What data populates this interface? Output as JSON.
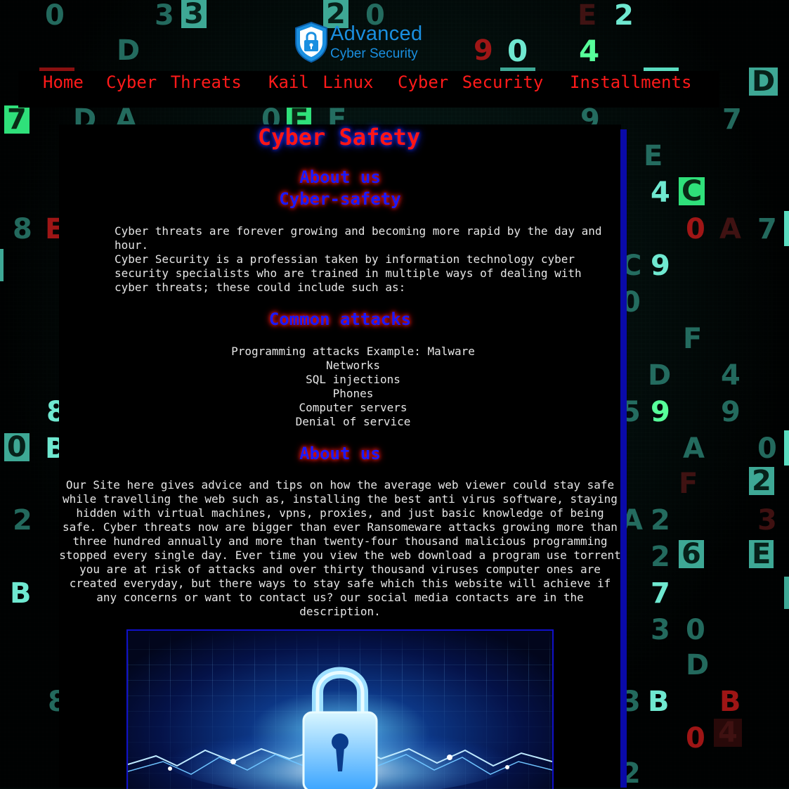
{
  "logo": {
    "line1": "Advanced",
    "line2": "Cyber Security",
    "icon": "lock-shield-icon",
    "color": "#1a8fe0"
  },
  "nav": {
    "items": [
      {
        "label": "Home"
      },
      {
        "label": "Cyber Threats"
      },
      {
        "label": "Kail Linux"
      },
      {
        "label": "Cyber Security"
      },
      {
        "label": "Installments"
      }
    ],
    "color": "#ff1a1a"
  },
  "main": {
    "title": "Cyber Safety",
    "about_heading": "About us",
    "cyber_safety_heading": "Cyber-safety",
    "intro_line1": "Cyber threats are forever growing and becoming more rapid by the day and hour.",
    "intro_line2": "Cyber Security is a professian taken by information technology cyber security specialists who are trained in multiple ways of dealing with cyber threats; these could include such as:",
    "attacks_heading": "Common attacks",
    "attacks": [
      "Programming attacks Example: Malware",
      "Networks",
      "SQL injections",
      "Phones",
      "Computer servers",
      "Denial of service"
    ],
    "about_heading_2": "About us",
    "about_text": "Our Site here gives advice and tips on how the average web viewer could stay safe while travelling the web such as, installing the best anti virus software, staying hidden with virtual machines, vpns, proxies, and just basic knowledge of being safe. Cyber threats now are bigger than ever Ransomeware attacks growing more than three hundred annually and more than twenty-four thousand malicious programming stopped every single day. Ever time you view the web download a program use torrent you are at risk of attacks and over thirty thousand viruses computer ones are created everyday, but there ways to stay safe which this website will achieve if any concerns or want to contact us? our social media contacts are in the description.",
    "image_icon": "padlock-lightning-image"
  },
  "colors": {
    "heading_red": "#ff1616",
    "heading_blue": "#1a1aff",
    "rail": "#0a0aa8",
    "panel": "#000000"
  }
}
